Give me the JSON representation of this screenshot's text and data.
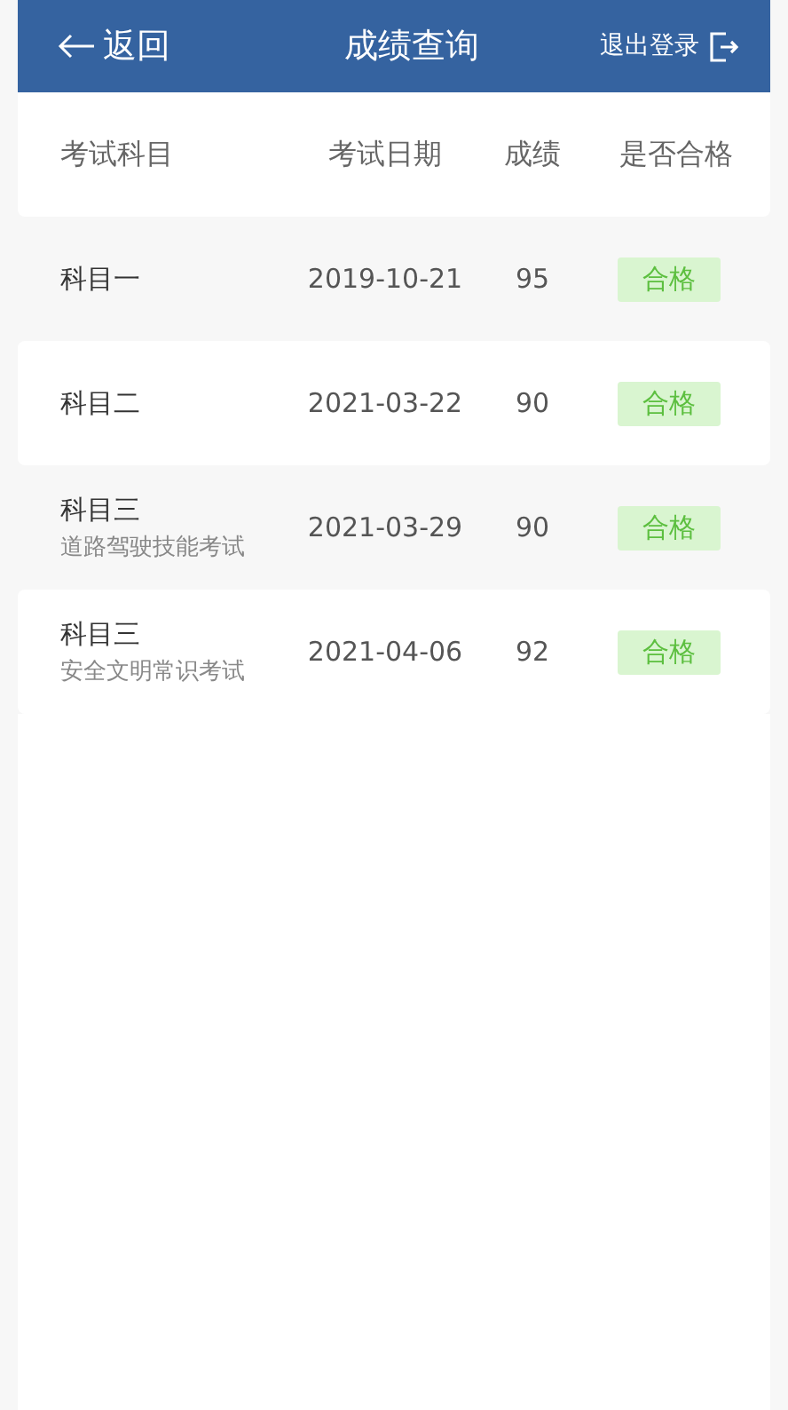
{
  "header": {
    "back": "返回",
    "title": "成绩查询",
    "logout": "退出登录"
  },
  "columns": [
    "考试科目",
    "考试日期",
    "成绩",
    "是否合格"
  ],
  "rows": [
    {
      "subject": "科目一",
      "date": "2019-10-21",
      "score": "95",
      "result": "合格"
    },
    {
      "subject": "科目二",
      "date": "2021-03-22",
      "score": "90",
      "result": "合格"
    },
    {
      "subject": "科目三",
      "note": "道路驾驶技能考试",
      "date": "2021-03-29",
      "score": "90",
      "result": "合格"
    },
    {
      "subject": "科目三",
      "note": "安全文明常识考试",
      "date": "2021-04-06",
      "score": "92",
      "result": "合格"
    }
  ]
}
